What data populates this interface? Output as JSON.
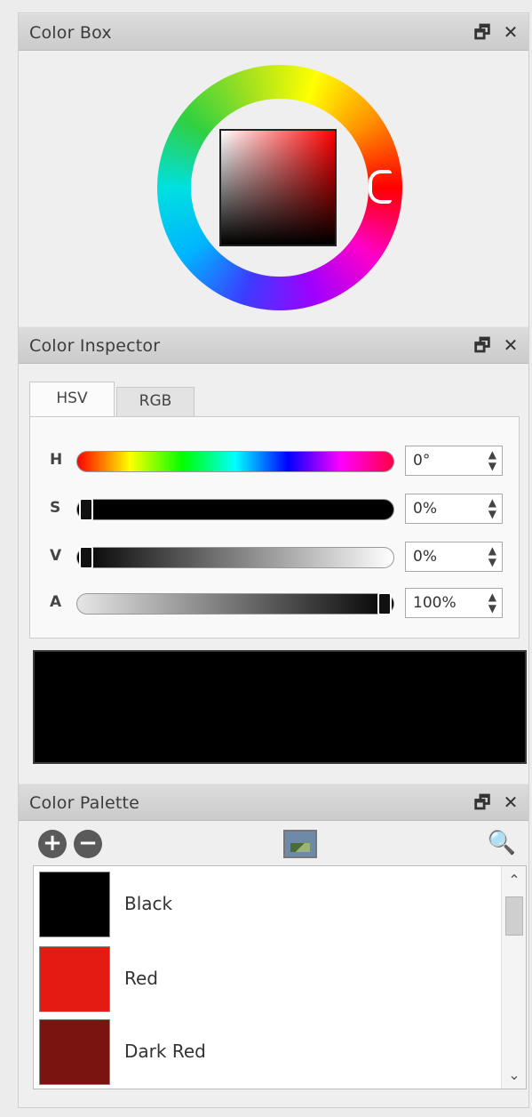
{
  "panels": {
    "color_box": {
      "title": "Color Box"
    },
    "color_inspector": {
      "title": "Color Inspector",
      "tabs": [
        {
          "label": "HSV"
        },
        {
          "label": "RGB"
        }
      ],
      "rows": [
        {
          "label": "H",
          "value": "0°"
        },
        {
          "label": "S",
          "value": "0%"
        },
        {
          "label": "V",
          "value": "0%"
        },
        {
          "label": "A",
          "value": "100%"
        }
      ],
      "preview_color": "#000000"
    },
    "color_palette": {
      "title": "Color Palette",
      "items": [
        {
          "label": "Black",
          "color": "#000000"
        },
        {
          "label": "Red",
          "color": "#e31b12"
        },
        {
          "label": "Dark Red",
          "color": "#7a1410"
        }
      ]
    }
  },
  "header_buttons": {
    "float": "🗗",
    "close": "✕"
  },
  "icons": {
    "add": "+",
    "remove": "−",
    "search": "🔍",
    "up": "⌃",
    "down": "⌄",
    "spin": "▴▾"
  }
}
